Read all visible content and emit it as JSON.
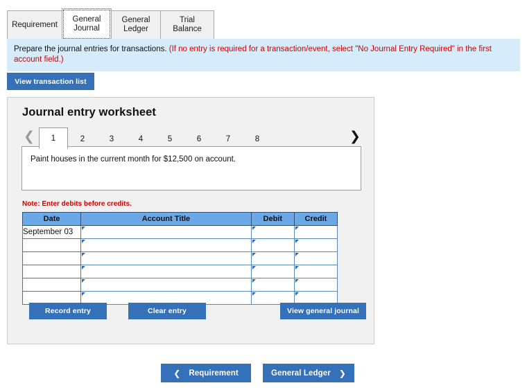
{
  "tabs": [
    {
      "label": "Requirement",
      "active": false
    },
    {
      "label": "General\nJournal",
      "active": true
    },
    {
      "label": "General\nLedger",
      "active": false
    },
    {
      "label": "Trial Balance",
      "active": false
    }
  ],
  "banner": {
    "text_plain": "Prepare the journal entries for transactions. ",
    "text_red": "(If no entry is required for a transaction/event, select \"No Journal Entry Required\" in the first account field.)"
  },
  "toolbar": {
    "view_transaction_list": "View transaction list"
  },
  "worksheet": {
    "title": "Journal entry worksheet",
    "pager": {
      "prev_icon": "chevron-left",
      "next_icon": "chevron-right",
      "pages": [
        "1",
        "2",
        "3",
        "4",
        "5",
        "6",
        "7",
        "8"
      ],
      "active_page": "1"
    },
    "transaction_text": "Paint houses in the current month for $12,500 on account.",
    "note": "Note: Enter debits before credits.",
    "table": {
      "headers": [
        "Date",
        "Account Title",
        "Debit",
        "Credit"
      ],
      "rows": [
        {
          "date": "September 03",
          "account": "",
          "debit": "",
          "credit": ""
        },
        {
          "date": "",
          "account": "",
          "debit": "",
          "credit": ""
        },
        {
          "date": "",
          "account": "",
          "debit": "",
          "credit": ""
        },
        {
          "date": "",
          "account": "",
          "debit": "",
          "credit": ""
        },
        {
          "date": "",
          "account": "",
          "debit": "",
          "credit": ""
        },
        {
          "date": "",
          "account": "",
          "debit": "",
          "credit": ""
        }
      ]
    },
    "actions": {
      "record_entry": "Record entry",
      "clear_entry": "Clear entry",
      "view_general_journal": "View general journal"
    }
  },
  "footer_nav": {
    "prev_label": "Requirement",
    "prev_icon": "chevron-left",
    "next_label": "General Ledger",
    "next_icon": "chevron-right"
  },
  "colors": {
    "button_blue": "#3571b8",
    "table_header_blue": "#6aa8e8",
    "banner_blue": "#d6ecfa",
    "panel_gray": "#f1f1f1",
    "alert_red": "#d10000"
  }
}
